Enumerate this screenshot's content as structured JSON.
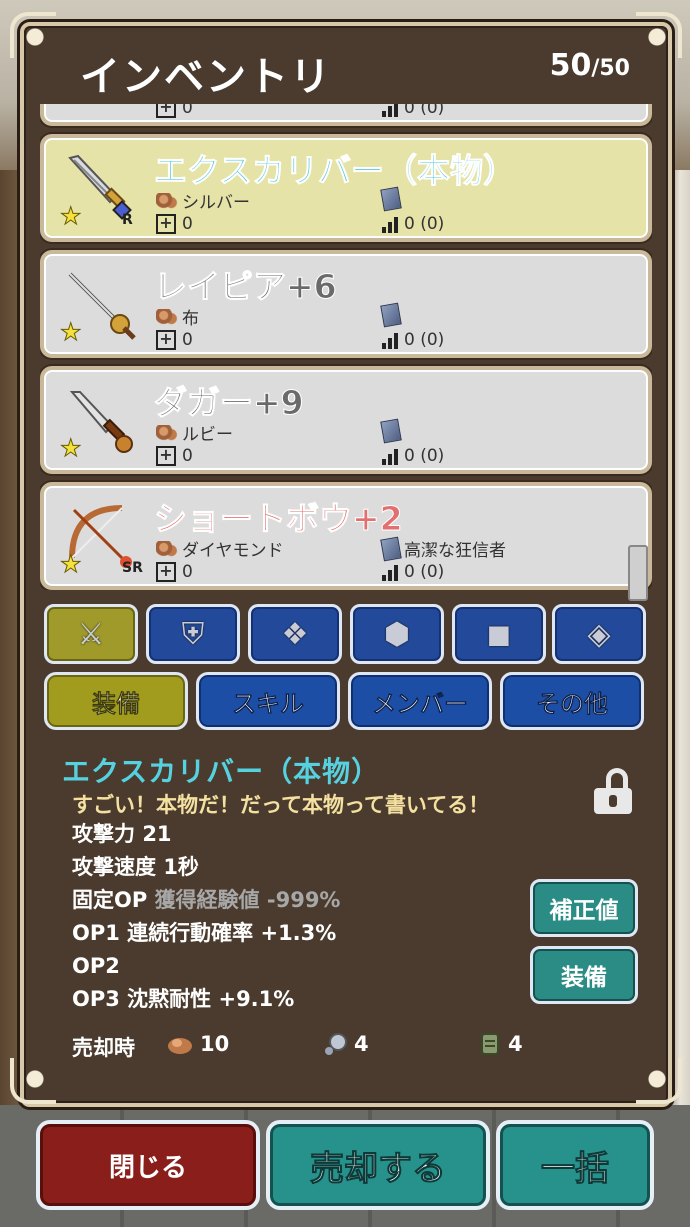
{
  "header": {
    "title": "インベントリ",
    "count": "50",
    "max": "50"
  },
  "items": [
    {
      "name": "エクスカリバー（本物）",
      "name_color": "cyan",
      "material": "シルバー",
      "option": "",
      "plus": "0",
      "stat": "0 (0)",
      "rarity": "R",
      "stars": 1,
      "icon": "sword-icon",
      "selected": true
    },
    {
      "name": "レイピア+6",
      "name_color": "gray",
      "material": "布",
      "option": "",
      "plus": "0",
      "stat": "0 (0)",
      "rarity": "",
      "stars": 1,
      "icon": "rapier-icon",
      "selected": false
    },
    {
      "name": "ダガー+9",
      "name_color": "gray",
      "material": "ルビー",
      "option": "",
      "plus": "0",
      "stat": "0 (0)",
      "rarity": "",
      "stars": 1,
      "icon": "dagger-icon",
      "selected": false
    },
    {
      "name": "ショートボウ+2",
      "name_color": "red",
      "material": "ダイヤモンド",
      "option": "高潔な狂信者",
      "plus": "0",
      "stat": "0 (0)",
      "rarity": "SR",
      "stars": 1,
      "icon": "bow-icon",
      "selected": false
    }
  ],
  "partial_top_item": {
    "plus": "0",
    "stat": "0 (0)"
  },
  "categories": [
    {
      "icon": "weapon-icon",
      "glyph": "⚔",
      "active": true
    },
    {
      "icon": "armor-icon",
      "glyph": "⛨",
      "active": false
    },
    {
      "icon": "cape-icon",
      "glyph": "❖",
      "active": false
    },
    {
      "icon": "shield-icon",
      "glyph": "⬢",
      "active": false
    },
    {
      "icon": "boots-icon",
      "glyph": "◼",
      "active": false
    },
    {
      "icon": "accessory-icon",
      "glyph": "◈",
      "active": false
    }
  ],
  "tabs": [
    {
      "label": "装備",
      "active": true
    },
    {
      "label": "スキル",
      "active": false
    },
    {
      "label": "メンバー",
      "active": false
    },
    {
      "label": "その他",
      "active": false
    }
  ],
  "detail": {
    "name": "エクスカリバー（本物）",
    "description": "すごい！本物だ！だって本物って書いてる！",
    "attack_label": "攻撃力",
    "attack_value": "21",
    "speed_label": "攻撃速度",
    "speed_value": "1秒",
    "fixed_op_label": "固定OP",
    "fixed_op_value": "獲得経験値 -999%",
    "op1": "OP1 連続行動確率 +1.3%",
    "op2": "OP2",
    "op3": "OP3 沈黙耐性 +9.1%",
    "sell_label": "売却時",
    "sell_ore": "10",
    "sell_gem": "4",
    "sell_scroll": "4",
    "correction_button": "補正値",
    "equip_button": "装備"
  },
  "footer": {
    "close": "閉じる",
    "sell": "売却する",
    "bulk": "一括"
  }
}
